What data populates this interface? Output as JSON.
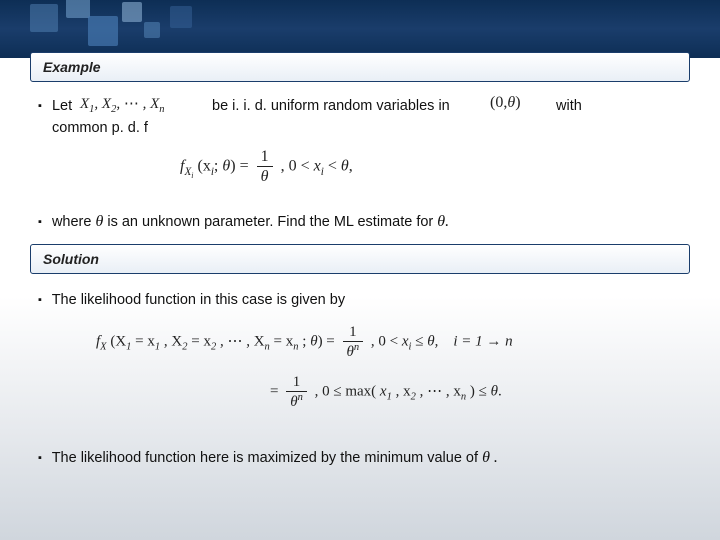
{
  "decor": {
    "note": "top-band-squares"
  },
  "headings": {
    "example": "Example",
    "solution": "Solution"
  },
  "bullets": {
    "b1_let": "Let",
    "b1_mid": "be i. i. d. uniform random variables in",
    "b1_with": "with",
    "b1_common": "common p. d. f",
    "b2_pre": "where",
    "b2_theta": "θ",
    "b2_mid": "is an unknown parameter. Find the  ML estimate for",
    "b2_theta2": "θ.",
    "b3": "The likelihood function in this case is given by",
    "b4_pre": "The likelihood function here is maximized by the minimum value of",
    "b4_theta": "θ ."
  },
  "math": {
    "vars_seq": {
      "x1": "X",
      "s1": "1",
      "x2": "X",
      "s2": "2",
      "ell": "⋯",
      "xn": "X",
      "sn": "n"
    },
    "interval": {
      "open": "(0,",
      "th": "θ",
      "close": ")"
    },
    "pdf": {
      "lhs_f": "f",
      "lhs_sub": "X",
      "lhs_si": "i",
      "lhs_paren_x": "(x",
      "lhs_i": "i",
      "lhs_semi": "; ",
      "lhs_th": "θ",
      "lhs_cl": ") =",
      "num": "1",
      "den": "θ",
      "cond_pre": ",   0 <",
      "cond_x": "x",
      "cond_i": "i",
      "cond_mid": "<",
      "cond_th": "θ",
      "cond_end": ","
    },
    "lik": {
      "lhs_f": "f",
      "lhs_sub": "X",
      "lhs_openp": "(X",
      "lhs_1": "1",
      "eq1": "= x",
      "eq1s": "1",
      "c1": ", X",
      "lhs_2": "2",
      "eq2": "= x",
      "eq2s": "2",
      "ell": ", ⋯ , X",
      "lhs_n": "n",
      "eqn": "= x",
      "eqns": "n",
      "semi": "; ",
      "th": "θ",
      "close": ") =",
      "num1": "1",
      "den1_th": "θ",
      "den1_n": "n",
      "cond1_pre": ",   0 <",
      "cond1_x": "x",
      "cond1_i": "i",
      "cond1_le": "≤",
      "cond1_th": "θ",
      "cond1_end": ",",
      "cond1_idx": "i = 1 → n",
      "line2_eq": "=",
      "num2": "1",
      "den2_th": "θ",
      "den2_n": "n",
      "max_pre": ",   0 ≤ max(",
      "max_x1": "x",
      "max_1": "1",
      "max_c": ", x",
      "max_2": "2",
      "max_ell": ", ⋯ , x",
      "max_n": "n",
      "max_close": ") ≤",
      "max_th": "θ",
      "max_end": "."
    }
  }
}
